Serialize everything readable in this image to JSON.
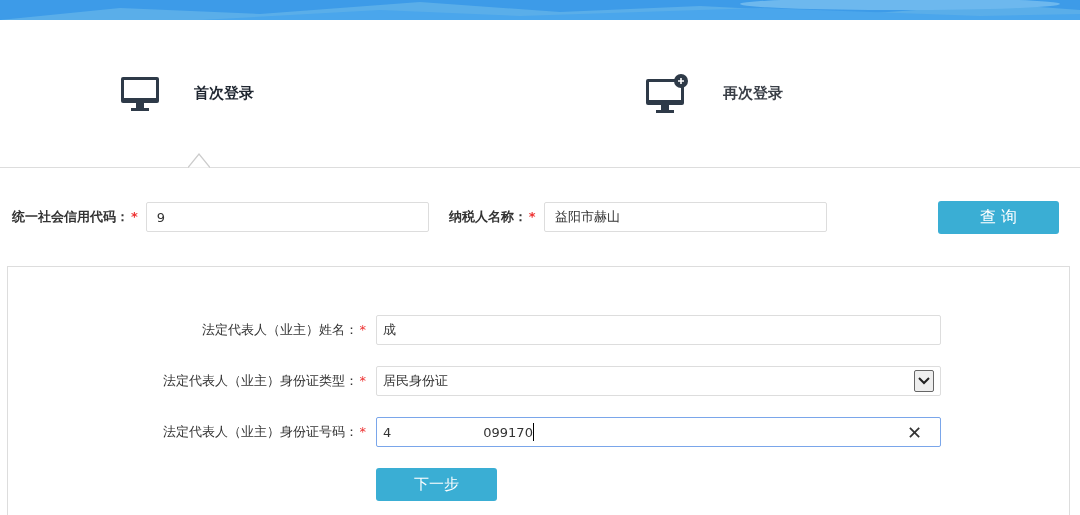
{
  "tabs": [
    {
      "label": "首次登录",
      "kind": "monitor",
      "selected": true
    },
    {
      "label": "再次登录",
      "kind": "monitor-plus",
      "selected": false
    }
  ],
  "query": {
    "fields": [
      {
        "label": "统一社会信用代码：",
        "required": "*",
        "value": "9"
      },
      {
        "label": "纳税人名称：",
        "required": "*",
        "value": "益阳市赫山"
      }
    ],
    "button": "查 询"
  },
  "form": {
    "rows": [
      {
        "kind": "text",
        "label": "法定代表人（业主）姓名：",
        "required": "*",
        "value": "成"
      },
      {
        "kind": "select",
        "label": "法定代表人（业主）身份证类型：",
        "required": "*",
        "value": "居民身份证"
      },
      {
        "kind": "clearable",
        "label": "法定代表人（业主）身份证号码：",
        "required": "*",
        "value_start": "4",
        "value_end": "099170",
        "focused": true,
        "clear": "✕"
      }
    ],
    "button": "下一步"
  }
}
